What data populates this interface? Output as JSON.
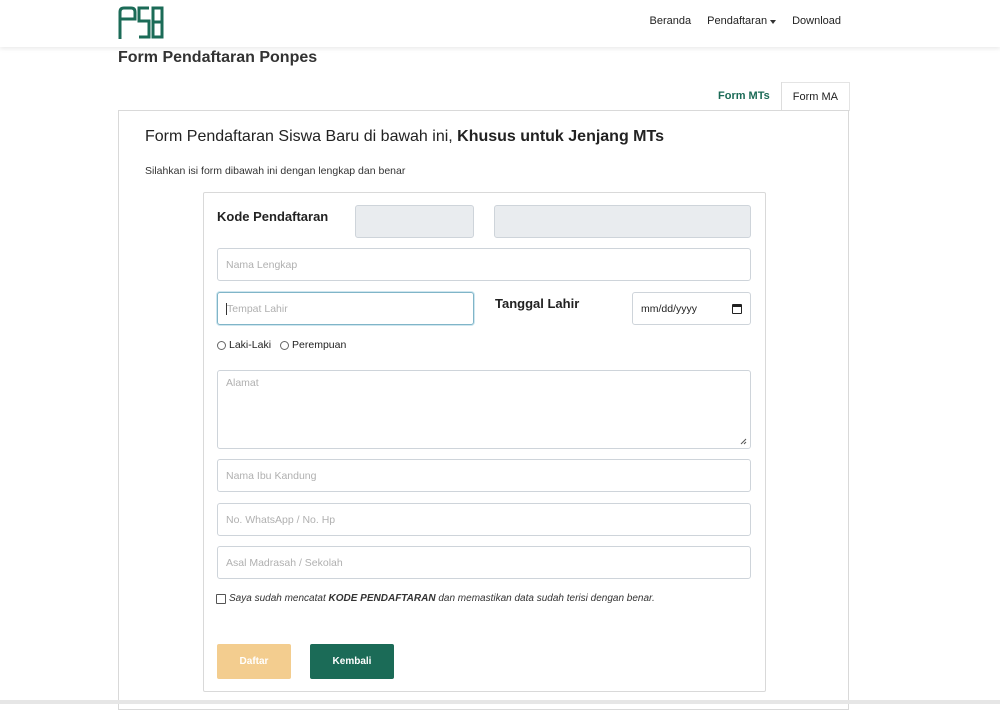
{
  "nav": {
    "links": [
      "Beranda",
      "Pendaftaran",
      "Download"
    ]
  },
  "page_title": "Form Pendaftaran Ponpes",
  "tabs": [
    "Form MTs",
    "Form MA"
  ],
  "card": {
    "heading_normal": "Form Pendaftaran Siswa Baru di bawah ini, ",
    "heading_bold": "Khusus untuk Jenjang MTs",
    "subtitle": "Silahkan isi form dibawah ini dengan lengkap dan benar"
  },
  "form": {
    "kode_label": "Kode Pendaftaran",
    "nama_placeholder": "Nama Lengkap",
    "tempat_placeholder": "Tempat Lahir",
    "tanggal_label": "Tanggal Lahir",
    "tanggal_value": "mm/dd/yyyy",
    "gender_options": [
      "Laki-Laki",
      "Perempuan"
    ],
    "alamat_placeholder": "Alamat",
    "ibu_placeholder": "Nama Ibu Kandung",
    "wa_placeholder": "No. WhatsApp / No. Hp",
    "asal_placeholder": "Asal Madrasah / Sekolah",
    "confirm_prefix": "Saya sudah mencatat ",
    "confirm_bold": "KODE PENDAFTARAN",
    "confirm_suffix": " dan memastikan data sudah terisi dengan benar.",
    "daftar_label": "Daftar",
    "kembali_label": "Kembali"
  },
  "colors": {
    "brand": "#1b6b57",
    "daftar_disabled": "#f3cd8f"
  }
}
